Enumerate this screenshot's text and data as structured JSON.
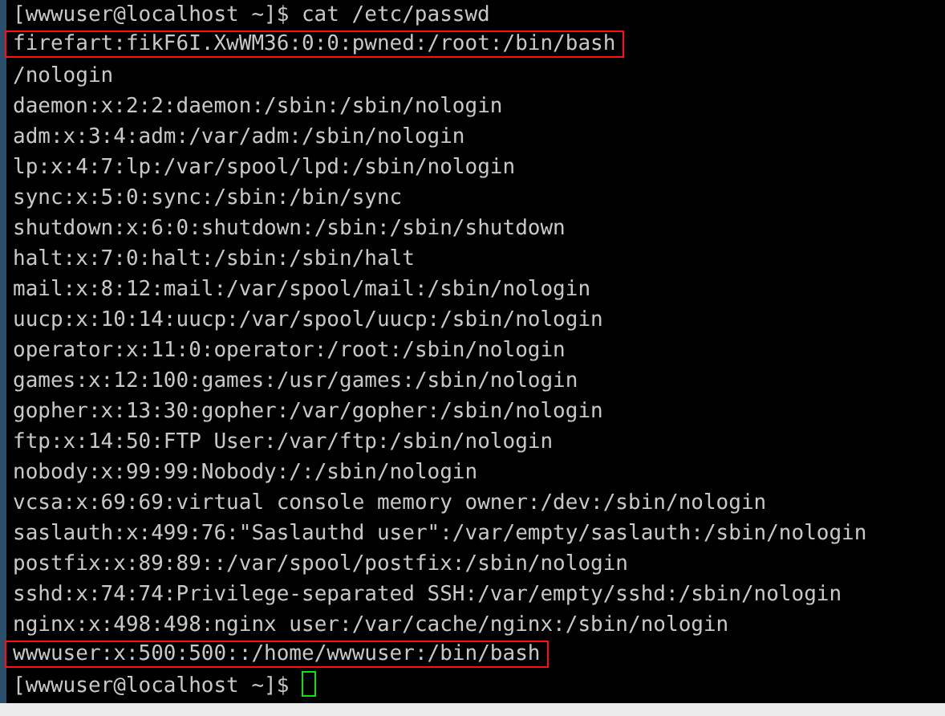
{
  "terminal": {
    "lines": [
      {
        "kind": "prompt",
        "prompt": "[wwwuser@localhost ~]$",
        "command": "cat /etc/passwd",
        "cursor": false,
        "highlighted": false
      },
      {
        "kind": "output",
        "text": "firefart:fikF6I.XwWM36:0:0:pwned:/root:/bin/bash",
        "highlighted": true
      },
      {
        "kind": "output",
        "text": "/nologin",
        "highlighted": false
      },
      {
        "kind": "output",
        "text": "daemon:x:2:2:daemon:/sbin:/sbin/nologin",
        "highlighted": false
      },
      {
        "kind": "output",
        "text": "adm:x:3:4:adm:/var/adm:/sbin/nologin",
        "highlighted": false
      },
      {
        "kind": "output",
        "text": "lp:x:4:7:lp:/var/spool/lpd:/sbin/nologin",
        "highlighted": false
      },
      {
        "kind": "output",
        "text": "sync:x:5:0:sync:/sbin:/bin/sync",
        "highlighted": false
      },
      {
        "kind": "output",
        "text": "shutdown:x:6:0:shutdown:/sbin:/sbin/shutdown",
        "highlighted": false
      },
      {
        "kind": "output",
        "text": "halt:x:7:0:halt:/sbin:/sbin/halt",
        "highlighted": false
      },
      {
        "kind": "output",
        "text": "mail:x:8:12:mail:/var/spool/mail:/sbin/nologin",
        "highlighted": false
      },
      {
        "kind": "output",
        "text": "uucp:x:10:14:uucp:/var/spool/uucp:/sbin/nologin",
        "highlighted": false
      },
      {
        "kind": "output",
        "text": "operator:x:11:0:operator:/root:/sbin/nologin",
        "highlighted": false
      },
      {
        "kind": "output",
        "text": "games:x:12:100:games:/usr/games:/sbin/nologin",
        "highlighted": false
      },
      {
        "kind": "output",
        "text": "gopher:x:13:30:gopher:/var/gopher:/sbin/nologin",
        "highlighted": false
      },
      {
        "kind": "output",
        "text": "ftp:x:14:50:FTP User:/var/ftp:/sbin/nologin",
        "highlighted": false
      },
      {
        "kind": "output",
        "text": "nobody:x:99:99:Nobody:/:/sbin/nologin",
        "highlighted": false
      },
      {
        "kind": "output",
        "text": "vcsa:x:69:69:virtual console memory owner:/dev:/sbin/nologin",
        "highlighted": false
      },
      {
        "kind": "output",
        "text": "saslauth:x:499:76:\"Saslauthd user\":/var/empty/saslauth:/sbin/nologin",
        "highlighted": false
      },
      {
        "kind": "output",
        "text": "postfix:x:89:89::/var/spool/postfix:/sbin/nologin",
        "highlighted": false
      },
      {
        "kind": "output",
        "text": "sshd:x:74:74:Privilege-separated SSH:/var/empty/sshd:/sbin/nologin",
        "highlighted": false
      },
      {
        "kind": "output",
        "text": "nginx:x:498:498:nginx user:/var/cache/nginx:/sbin/nologin",
        "highlighted": false
      },
      {
        "kind": "output",
        "text": "wwwuser:x:500:500::/home/wwwuser:/bin/bash",
        "highlighted": true
      },
      {
        "kind": "prompt",
        "prompt": "[wwwuser@localhost ~]$",
        "cursor": true,
        "highlighted": false
      }
    ]
  }
}
